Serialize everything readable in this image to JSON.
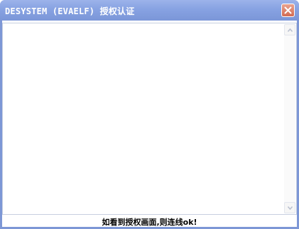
{
  "window": {
    "title": "DESYSTEM (EVAELF) 授权认证",
    "close_icon": "close-icon"
  },
  "content": {
    "text": ""
  },
  "scrollbar": {
    "up_icon": "scroll-up-arrow-icon",
    "down_icon": "scroll-down-arrow-icon"
  },
  "status": {
    "message": "如看到授权画面,则连线ok!"
  },
  "colors": {
    "titlebar": "#87a2e2",
    "close_button": "#d26a52",
    "frame": "#7d97d6"
  }
}
